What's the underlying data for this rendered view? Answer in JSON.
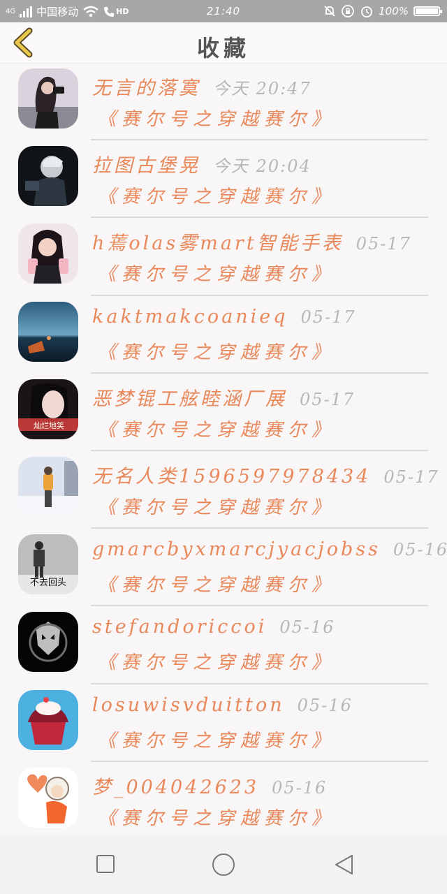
{
  "status": {
    "network": "4G",
    "carrier": "中国移动",
    "hd": "HD",
    "time": "21:40",
    "battery": "100%"
  },
  "header": {
    "title": "收藏",
    "back_icon": "chevron-left-icon"
  },
  "favorites": [
    {
      "name": "无言的落寞",
      "time": "今天 20:47",
      "book": "《赛尔号之穿越赛尔》",
      "avatar": "avatar-girl-camera"
    },
    {
      "name": "拉图古堡晃",
      "time": "今天 20:04",
      "book": "《赛尔号之穿越赛尔》",
      "avatar": "avatar-dark-figure"
    },
    {
      "name": "h蔫olas雾mart智能手表",
      "time": "05-17",
      "book": "《赛尔号之穿越赛尔》",
      "avatar": "avatar-little-girl"
    },
    {
      "name": "kaktmakcoanieq",
      "time": "05-17",
      "book": "《赛尔号之穿越赛尔》",
      "avatar": "avatar-night-sea"
    },
    {
      "name": "恶梦锟工舷睦涵厂展",
      "time": "05-17",
      "book": "《赛尔号之穿越赛尔》",
      "avatar": "avatar-girl-red-text",
      "avatar_text": "灿烂地笑"
    },
    {
      "name": "无名人类15965979784​34",
      "time": "05-17",
      "book": "《赛尔号之穿越赛尔》",
      "avatar": "avatar-snow-figure"
    },
    {
      "name": "gmarcbyxmarcjyacjobss",
      "time": "05-16",
      "book": "《赛尔号之穿越赛尔》",
      "avatar": "avatar-man-standing",
      "avatar_text": "不去回头"
    },
    {
      "name": "stefandoriccoi",
      "time": "05-16",
      "book": "《赛尔号之穿越赛尔》",
      "avatar": "avatar-skull-wolf"
    },
    {
      "name": "losuwisvduitton",
      "time": "05-16",
      "book": "《赛尔号之穿越赛尔》",
      "avatar": "avatar-cupcake"
    },
    {
      "name": "梦_004042623",
      "time": "05-16",
      "book": "《赛尔号之穿越赛尔》",
      "avatar": "avatar-cartoon-heart"
    }
  ],
  "navbar": {
    "recent_icon": "square-icon",
    "home_icon": "circle-icon",
    "back_icon": "triangle-back-icon"
  },
  "colors": {
    "accent": "#e9885a",
    "time_gray": "#b9b6b7",
    "status_bar": "#a9a6a7",
    "back_chevron": "#e8c84a"
  }
}
